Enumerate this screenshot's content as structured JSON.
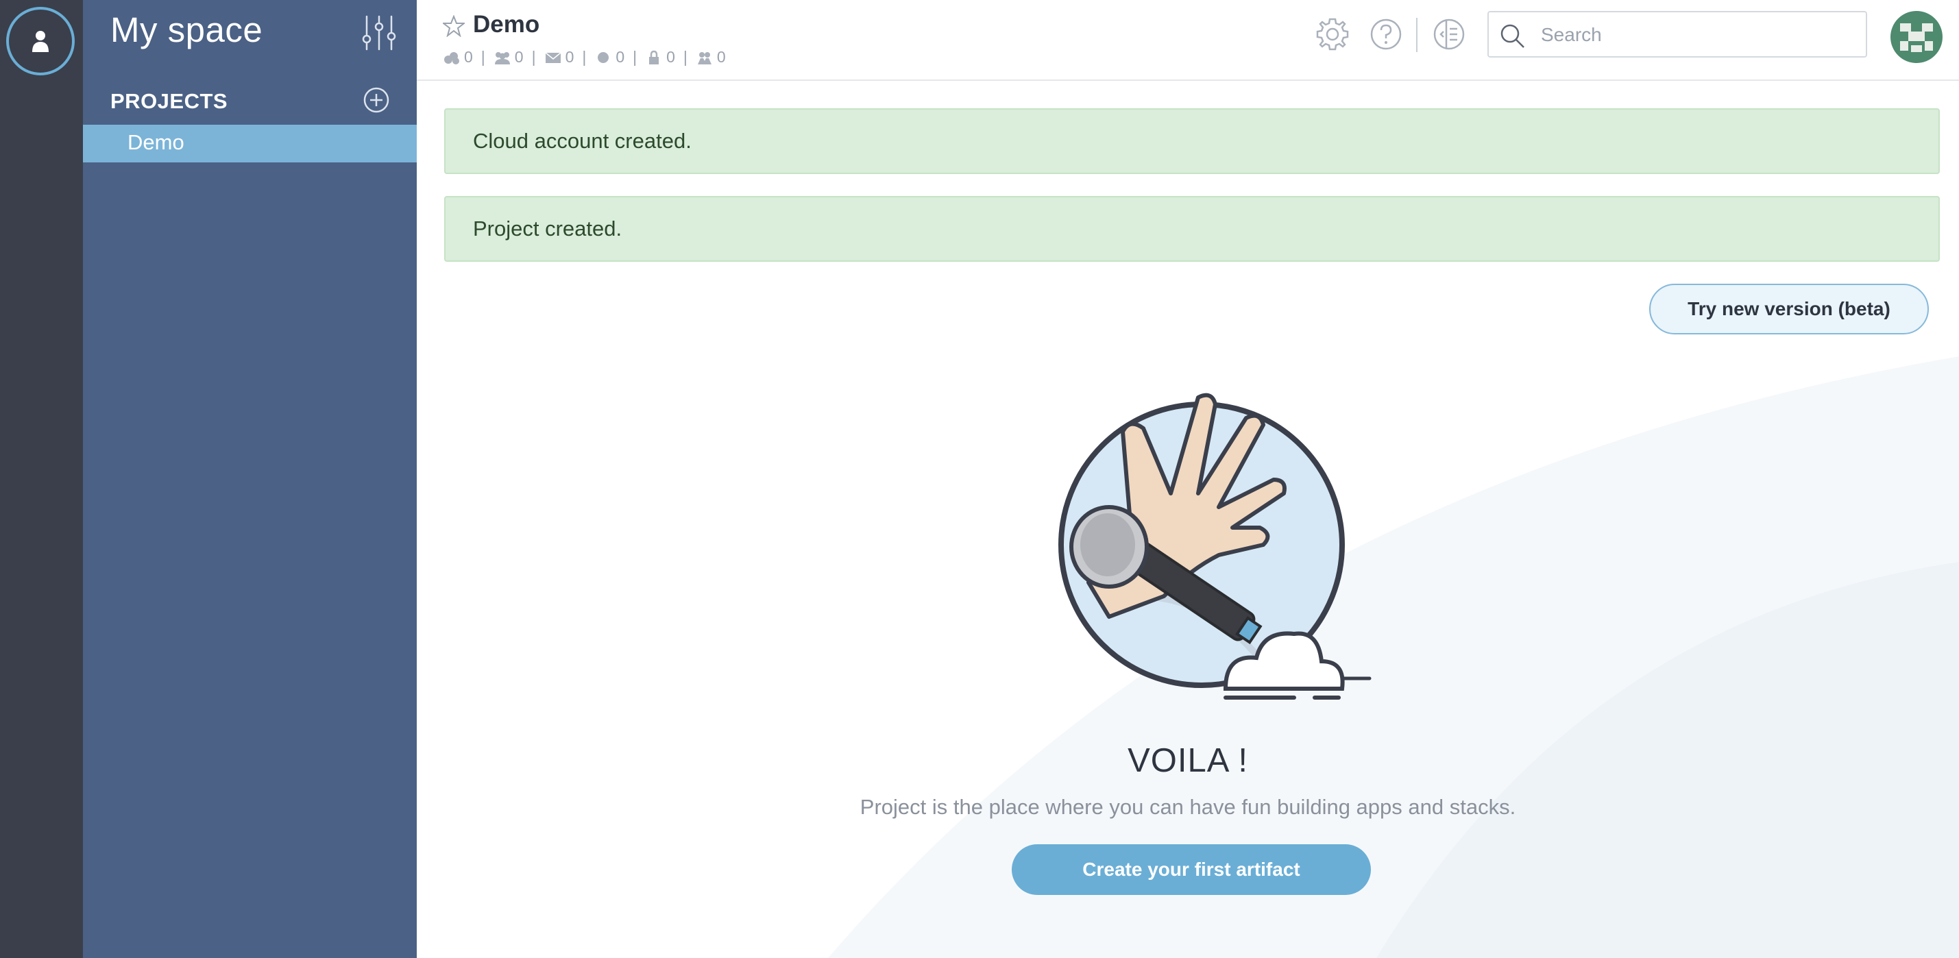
{
  "sidebar": {
    "title": "My space",
    "projects_heading": "PROJECTS",
    "projects": [
      {
        "label": "Demo",
        "active": true
      }
    ]
  },
  "header": {
    "project_title": "Demo",
    "counters": [
      {
        "icon": "clouds-icon",
        "value": "0"
      },
      {
        "icon": "team-icon",
        "value": "0"
      },
      {
        "icon": "envelope-icon",
        "value": "0"
      },
      {
        "icon": "circle-icon",
        "value": "0"
      },
      {
        "icon": "lock-icon",
        "value": "0"
      },
      {
        "icon": "people-icon",
        "value": "0"
      }
    ],
    "search_placeholder": "Search"
  },
  "alerts": [
    {
      "text": "Cloud account created."
    },
    {
      "text": "Project created."
    }
  ],
  "beta_button": "Try new version (beta)",
  "empty_state": {
    "heading": "VOILA !",
    "subtitle": "Project is the place where you can have fun building apps and stacks.",
    "cta_label": "Create your first artifact"
  },
  "colors": {
    "rail": "#3a3f4b",
    "sidebar": "#4b6185",
    "active_item": "#7cb4d8",
    "accent": "#6aaed6",
    "alert_bg": "#dbeddb"
  }
}
